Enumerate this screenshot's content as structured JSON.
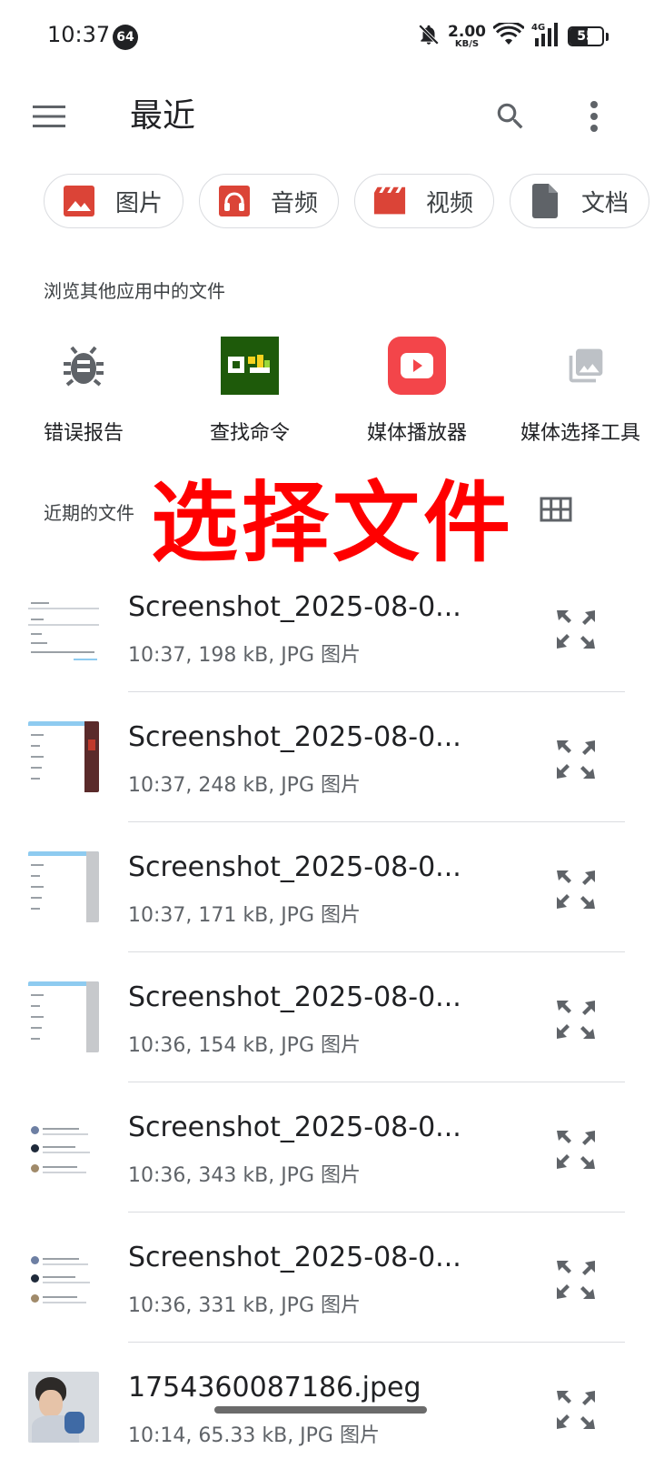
{
  "status_bar": {
    "time": "10:37",
    "notification_count": "64",
    "net_speed_value": "2.00",
    "net_speed_unit": "KB/S",
    "network_type": "4G",
    "battery_level": "55",
    "icons": [
      "bell-off-icon",
      "wifi-icon",
      "signal-icon",
      "battery-icon"
    ]
  },
  "app_bar": {
    "title": "最近",
    "icons": [
      "menu-icon",
      "search-icon",
      "more-vert-icon"
    ]
  },
  "chips": [
    {
      "label": "图片",
      "icon": "image-icon",
      "color": "#db4437"
    },
    {
      "label": "音频",
      "icon": "headphones-icon",
      "color": "#db4437"
    },
    {
      "label": "视频",
      "icon": "movie-icon",
      "color": "#db4437"
    },
    {
      "label": "文档",
      "icon": "document-icon",
      "color": "#5f6368"
    }
  ],
  "browse_section": {
    "title": "浏览其他应用中的文件",
    "apps": [
      {
        "name": "错误报告",
        "icon": "bug-icon"
      },
      {
        "name": "查找命令",
        "icon": "find-command-icon"
      },
      {
        "name": "媒体播放器",
        "icon": "youtube-play-icon"
      },
      {
        "name": "媒体选择工具",
        "icon": "photo-library-icon"
      }
    ]
  },
  "recent_section": {
    "title": "近期的文件",
    "overlay_text": "选择文件",
    "view_toggle_icon": "grid-view-icon"
  },
  "files": [
    {
      "name": "Screenshot_2025-08-0...",
      "meta": "10:37, 198 kB, JPG 图片",
      "thumb": "list-light"
    },
    {
      "name": "Screenshot_2025-08-0...",
      "meta": "10:37, 248 kB, JPG 图片",
      "thumb": "list-red"
    },
    {
      "name": "Screenshot_2025-08-0...",
      "meta": "10:37, 171 kB, JPG 图片",
      "thumb": "list-blue-gray"
    },
    {
      "name": "Screenshot_2025-08-0...",
      "meta": "10:36, 154 kB, JPG 图片",
      "thumb": "list-blue-gray"
    },
    {
      "name": "Screenshot_2025-08-0...",
      "meta": "10:36, 343 kB, JPG 图片",
      "thumb": "chat"
    },
    {
      "name": "Screenshot_2025-08-0...",
      "meta": "10:36, 331 kB, JPG 图片",
      "thumb": "chat"
    },
    {
      "name": "1754360087186.jpeg",
      "meta": "10:14, 65.33 kB, JPG 图片",
      "thumb": "photo"
    }
  ],
  "colors": {
    "accent_red": "#db4437",
    "overlay_red": "#ff0000",
    "text_primary": "#202124",
    "text_secondary": "#5f6368",
    "divider": "#dadce0"
  }
}
